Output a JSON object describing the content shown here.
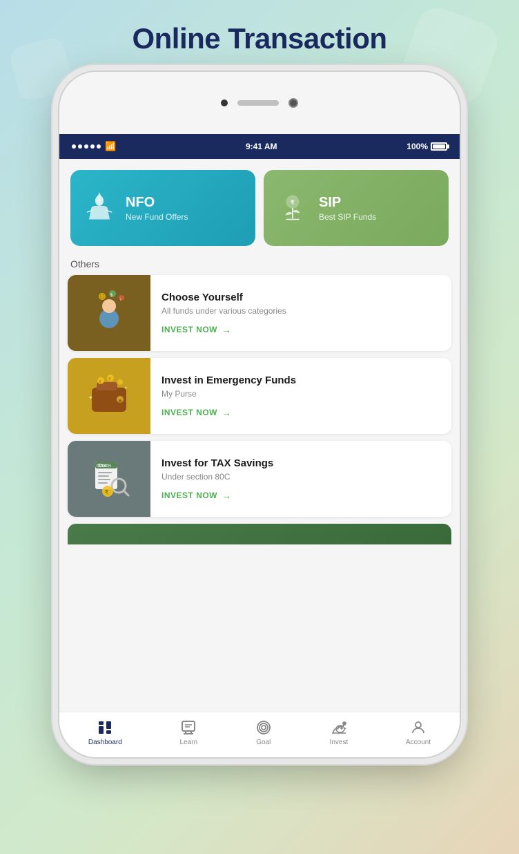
{
  "page": {
    "title": "Online Transaction",
    "background_colors": [
      "#b8dde8",
      "#c5e8d5",
      "#d4e8c8",
      "#e8d4b8"
    ]
  },
  "status_bar": {
    "time": "9:41 AM",
    "battery": "100%",
    "signal_dots": 5
  },
  "top_cards": [
    {
      "id": "nfo",
      "title": "NFO",
      "subtitle": "New Fund Offers",
      "bg_color": "#2bb5c8"
    },
    {
      "id": "sip",
      "title": "SIP",
      "subtitle": "Best SIP Funds",
      "bg_color": "#8ab86e"
    }
  ],
  "others_label": "Others",
  "list_items": [
    {
      "id": "choose-yourself",
      "title": "Choose Yourself",
      "subtitle": "All funds under various categories",
      "cta": "INVEST NOW",
      "bg_color": "#7a6020"
    },
    {
      "id": "emergency-funds",
      "title": "Invest in Emergency Funds",
      "subtitle": "My Purse",
      "cta": "INVEST NOW",
      "bg_color": "#c8a020"
    },
    {
      "id": "tax-savings",
      "title": "Invest for TAX Savings",
      "subtitle": "Under section 80C",
      "cta": "INVEST NOW",
      "bg_color": "#6a7a7a"
    }
  ],
  "bottom_nav": {
    "items": [
      {
        "id": "dashboard",
        "label": "Dashboard",
        "active": true
      },
      {
        "id": "learn",
        "label": "Learn",
        "active": false
      },
      {
        "id": "goal",
        "label": "Goal",
        "active": false
      },
      {
        "id": "invest",
        "label": "Invest",
        "active": false
      },
      {
        "id": "account",
        "label": "Account",
        "active": false
      }
    ]
  }
}
